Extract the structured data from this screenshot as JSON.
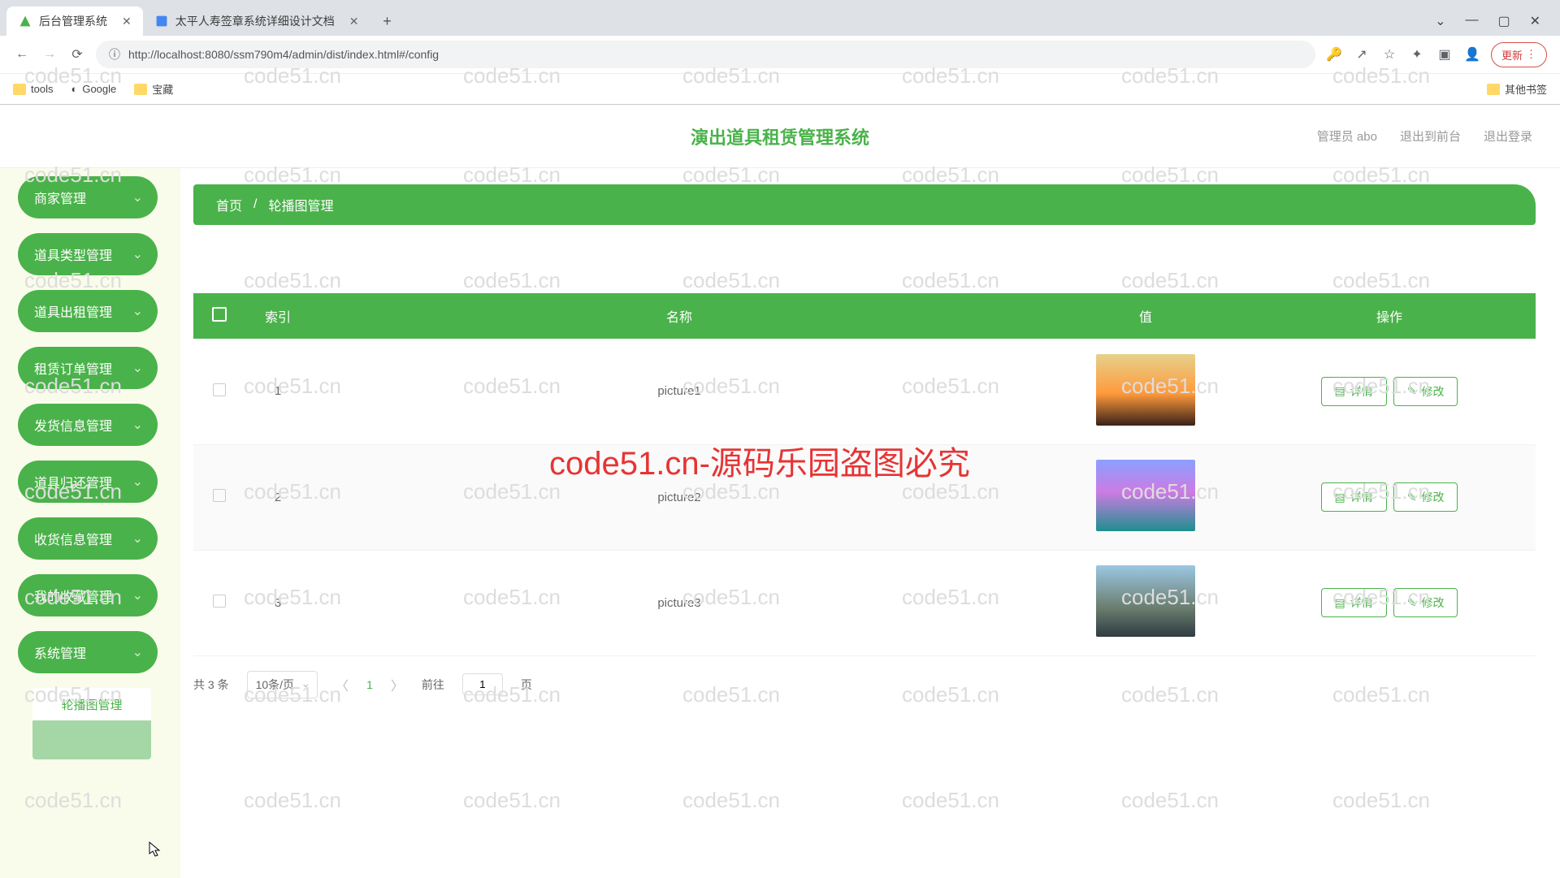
{
  "browser": {
    "tabs": [
      {
        "title": "后台管理系统",
        "fav_color": "#4ab24a",
        "active": true
      },
      {
        "title": "太平人寿签章系统详细设计文档",
        "fav_color": "#4285f4",
        "active": false
      }
    ],
    "url": "http://localhost:8080/ssm790m4/admin/dist/index.html#/config",
    "update_label": "更新",
    "bookmarks": [
      {
        "label": "tools",
        "type": "folder"
      },
      {
        "label": "Google",
        "type": "site"
      },
      {
        "label": "宝藏",
        "type": "folder"
      }
    ],
    "other_bookmarks_label": "其他书签",
    "icons": {
      "key": "🔑",
      "share": "↗",
      "star": "☆",
      "ext": "✦",
      "panel": "▣",
      "user": "👤"
    }
  },
  "header": {
    "title": "演出道具租赁管理系统",
    "right": {
      "admin": "管理员 abo",
      "front": "退出到前台",
      "logout": "退出登录"
    }
  },
  "sidebar": {
    "items": [
      {
        "label": "商家管理"
      },
      {
        "label": "道具类型管理"
      },
      {
        "label": "道具出租管理"
      },
      {
        "label": "租赁订单管理"
      },
      {
        "label": "发货信息管理"
      },
      {
        "label": "道具归还管理"
      },
      {
        "label": "收货信息管理"
      },
      {
        "label": "我的收藏管理"
      },
      {
        "label": "系统管理"
      }
    ],
    "submenu": {
      "label": "轮播图管理"
    }
  },
  "breadcrumb": {
    "home": "首页",
    "sep": "/",
    "current": "轮播图管理"
  },
  "table": {
    "columns": {
      "check": "",
      "index": "索引",
      "name": "名称",
      "value": "值",
      "actions": "操作"
    },
    "rows": [
      {
        "index": "1",
        "name": "picture1",
        "thumb": "th1"
      },
      {
        "index": "2",
        "name": "picture2",
        "thumb": "th2"
      },
      {
        "index": "3",
        "name": "picture3",
        "thumb": "th3"
      }
    ],
    "action_labels": {
      "detail": "详情",
      "edit": "修改"
    }
  },
  "pager": {
    "total_text": "共 3 条",
    "page_size_text": "10条/页",
    "current": "1",
    "goto_label": "前往",
    "goto_value": "1",
    "page_suffix": "页"
  },
  "watermark": {
    "text": "code51.cn",
    "red_text": "code51.cn-源码乐园盗图必究"
  }
}
